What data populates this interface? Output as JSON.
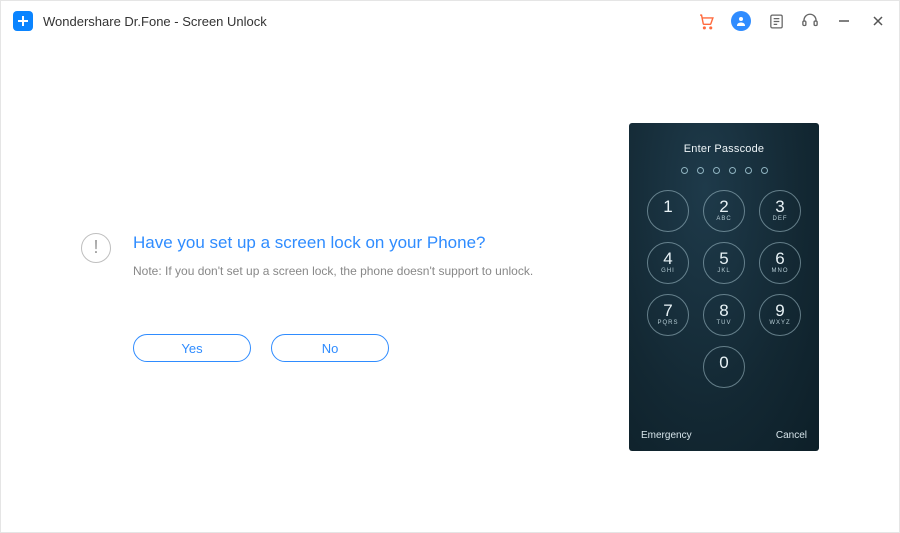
{
  "app": {
    "title": "Wondershare Dr.Fone - Screen Unlock"
  },
  "titlebar": {
    "cart": "cart-icon",
    "user": "user-icon",
    "feedback": "feedback-icon",
    "support": "support-icon",
    "minimize": "minimize-icon",
    "close": "close-icon"
  },
  "question": {
    "heading": "Have you set up a screen lock on your Phone?",
    "note": "Note: If you don't set up a screen lock, the phone doesn't support to unlock.",
    "info_glyph": "!"
  },
  "buttons": {
    "yes": "Yes",
    "no": "No"
  },
  "phone": {
    "passcode_label": "Enter Passcode",
    "dots_count": 6,
    "keys": [
      {
        "digit": "1",
        "letters": ""
      },
      {
        "digit": "2",
        "letters": "ABC"
      },
      {
        "digit": "3",
        "letters": "DEF"
      },
      {
        "digit": "4",
        "letters": "GHI"
      },
      {
        "digit": "5",
        "letters": "JKL"
      },
      {
        "digit": "6",
        "letters": "MNO"
      },
      {
        "digit": "7",
        "letters": "PQRS"
      },
      {
        "digit": "8",
        "letters": "TUV"
      },
      {
        "digit": "9",
        "letters": "WXYZ"
      },
      {
        "digit": "0",
        "letters": ""
      }
    ],
    "emergency": "Emergency",
    "cancel": "Cancel"
  },
  "colors": {
    "accent": "#2f8cff",
    "cart": "#ff6a3d",
    "phone_bg": "#132833"
  }
}
